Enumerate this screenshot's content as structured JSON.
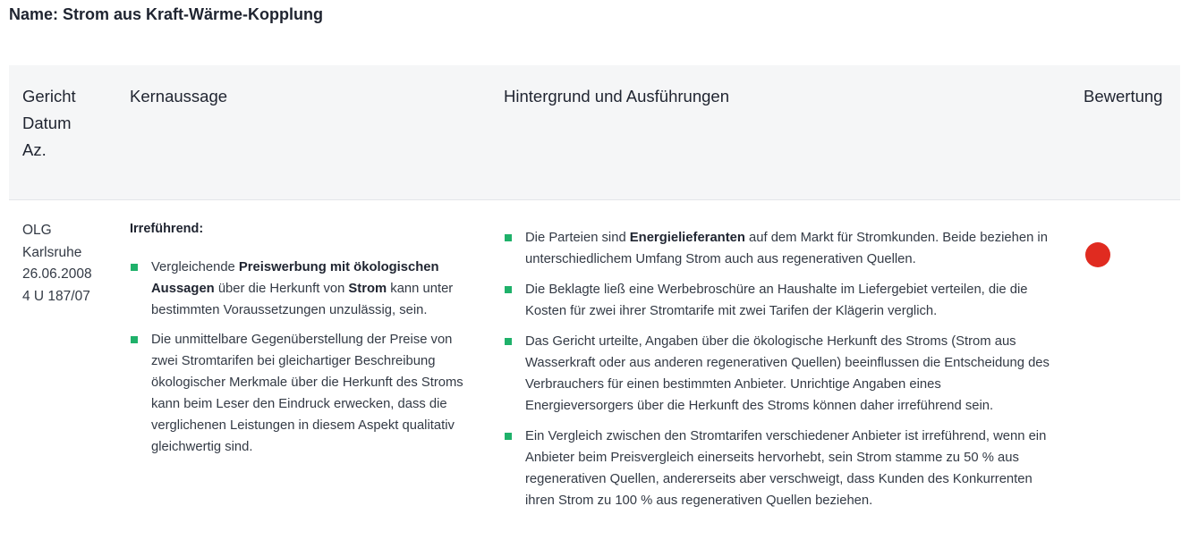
{
  "page_title": "Name: Strom aus Kraft-Wärme-Kopplung",
  "table": {
    "headers": {
      "court": "Gericht\nDatum\nAz.",
      "core": "Kernaussage",
      "background": "Hintergrund und Ausführungen",
      "rating": "Bewertung"
    },
    "row": {
      "court_lines": [
        "OLG",
        "Karlsruhe",
        "26.06.2008",
        "4 U 187/07"
      ],
      "core_heading": "Irreführend:",
      "core_bullets": [
        [
          {
            "t": "Vergleichende "
          },
          {
            "t": "Preiswerbung mit ökologischen Aussagen",
            "b": true
          },
          {
            "t": " über die Herkunft von "
          },
          {
            "t": "Strom",
            "b": true
          },
          {
            "t": " kann unter bestimmten Voraussetzungen unzulässig, sein."
          }
        ],
        [
          {
            "t": "Die unmittelbare Gegenüberstellung der Preise von zwei Stromtarifen bei gleichartiger Beschreibung ökologischer Merkmale über die Herkunft des Stroms kann beim Leser den Eindruck erwecken, dass die verglichenen Leistungen in diesem Aspekt qualitativ gleichwertig sind."
          }
        ]
      ],
      "background_bullets": [
        [
          {
            "t": "Die Parteien sind "
          },
          {
            "t": "Energielieferanten",
            "b": true
          },
          {
            "t": " auf dem Markt für Stromkunden. Beide beziehen in unterschiedlichem Umfang Strom auch aus regenerativen Quellen."
          }
        ],
        [
          {
            "t": "Die Beklagte ließ eine Werbebroschüre an Haushalte im Liefergebiet verteilen, die die Kosten für zwei ihrer Stromtarife mit zwei Tarifen der Klägerin verglich."
          }
        ],
        [
          {
            "t": "Das Gericht urteilte, Angaben über die ökologische Herkunft des Stroms (Strom aus Wasserkraft oder aus anderen regenerativen Quellen) beeinflussen die Entscheidung des Verbrauchers für einen bestimmten Anbieter. Unrichtige Angaben eines Energieversorgers über die Herkunft des Stroms können daher irreführend sein."
          }
        ],
        [
          {
            "t": "Ein Vergleich zwischen den Stromtarifen verschiedener Anbieter ist irreführend, wenn ein Anbieter beim Preisvergleich einerseits hervorhebt, sein Strom stamme zu 50 % aus regenerativen Quellen, andererseits aber verschweigt, dass Kunden des Konkurrenten ihren Strom zu 100 % aus regenerativen Quellen beziehen."
          }
        ]
      ],
      "rating_color": "#e02b20",
      "bullet_color": "#1fb16a"
    }
  }
}
